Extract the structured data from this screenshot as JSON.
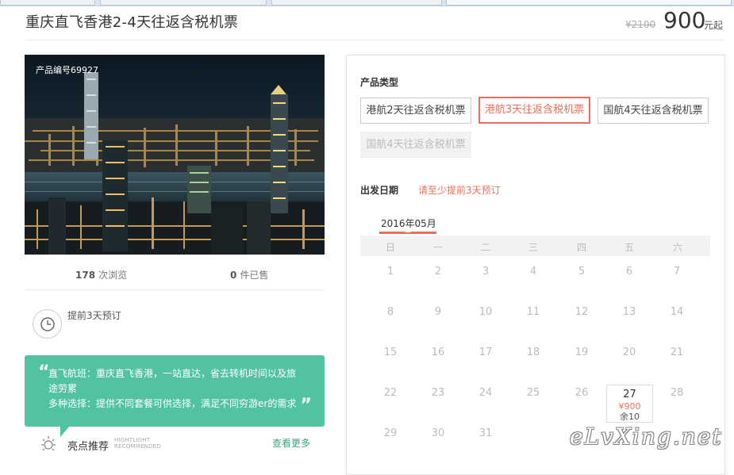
{
  "product": {
    "title": "重庆直飞香港2-4天往返含税机票",
    "original_price": "¥2100",
    "price": "900",
    "price_unit": "元起",
    "code": "产品编号69927"
  },
  "stats": {
    "views_count": "178",
    "views_label": "次浏览",
    "sold_count": "0",
    "sold_label": "件已售"
  },
  "advance": {
    "text": "提前3天预订",
    "icon": "clock-icon"
  },
  "highlight_box": {
    "line1": "直飞航班：重庆直飞香港，一站直达，省去转机时间以及旅途劳累",
    "line2": "多种选择：提供不同套餐可供选择，满足不同穷游er的需求",
    "open_quote": "“",
    "close_quote": "”"
  },
  "highlights": {
    "label": "亮点推荐",
    "en_line1": "HIGHTLIGHT",
    "en_line2": "RECOMMENDED",
    "more": "查看更多",
    "icon": "sun-icon"
  },
  "booking": {
    "type_title": "产品类型",
    "options": [
      {
        "label": "港航2天往返含税机票",
        "state": "normal"
      },
      {
        "label": "港航3天往返含税机票",
        "state": "selected"
      },
      {
        "label": "国航4天往返含税机票",
        "state": "normal"
      },
      {
        "label": "国航4天往返含税机票",
        "state": "disabled"
      }
    ],
    "date_title": "出发日期",
    "date_note": "请至少提前3天预订",
    "month": "2016年05月",
    "weekdays": [
      "日",
      "一",
      "二",
      "三",
      "四",
      "五",
      "六"
    ],
    "days": [
      "1",
      "2",
      "3",
      "4",
      "5",
      "6",
      "7",
      "8",
      "9",
      "10",
      "11",
      "12",
      "13",
      "14",
      "15",
      "16",
      "17",
      "18",
      "19",
      "20",
      "21",
      "22",
      "23",
      "24",
      "25",
      "26",
      "27",
      "28",
      "29",
      "30",
      "31"
    ],
    "available_day": {
      "day": "27",
      "price": "¥900",
      "remaining": "余10"
    }
  },
  "watermark": "eLvXing.net",
  "colors": {
    "accent": "#e8705a",
    "green": "#52c3a1",
    "link_green": "#3aa482"
  }
}
